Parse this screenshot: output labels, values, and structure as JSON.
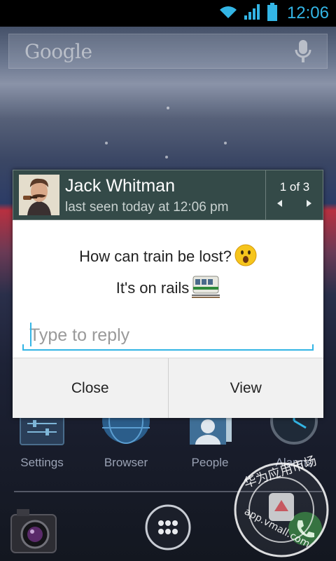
{
  "status_bar": {
    "time": "12:06",
    "icons": [
      "wifi-icon",
      "signal-icon",
      "battery-icon"
    ],
    "accent": "#33b5e5"
  },
  "search": {
    "logo_text": "Google",
    "icon": "mic-icon"
  },
  "notification": {
    "contact_name": "Jack Whitman",
    "last_seen": "last seen today at 12:06 pm",
    "pager": "1 of 3",
    "messages": [
      {
        "text": "How can train be lost?",
        "emoji": "surprised-face-emoji"
      },
      {
        "text": "It's on rails",
        "emoji": "train-emoji"
      }
    ],
    "reply_placeholder": "Type to reply",
    "buttons": {
      "close": "Close",
      "view": "View"
    },
    "header_color": "#344a48"
  },
  "home": {
    "apps": [
      {
        "label": "Settings",
        "icon": "settings-icon"
      },
      {
        "label": "Browser",
        "icon": "globe-icon"
      },
      {
        "label": "People",
        "icon": "contacts-icon"
      },
      {
        "label": "Alarms",
        "icon": "clock-icon"
      }
    ],
    "dock": [
      "camera-icon",
      "app-drawer-icon",
      "phone-icon"
    ]
  },
  "watermark": {
    "top_text": "华为应用市场",
    "bottom_text": "app.vmall.com"
  }
}
